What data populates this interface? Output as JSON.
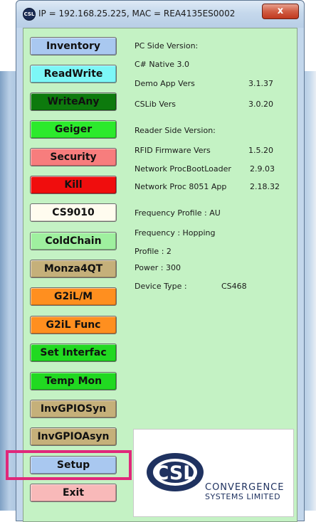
{
  "window": {
    "title": "IP = 192.168.25.225, MAC = REA4135ES0002",
    "close_label": "x",
    "app_icon_text": "CSL"
  },
  "buttons": [
    {
      "id": "inventory",
      "label": "Inventory",
      "bg": "#a9c8f0"
    },
    {
      "id": "readwrite",
      "label": "ReadWrite",
      "bg": "#7cf7f7"
    },
    {
      "id": "writeany",
      "label": "WriteAny",
      "bg": "#0d7a0d"
    },
    {
      "id": "geiger",
      "label": "Geiger",
      "bg": "#2cea2c"
    },
    {
      "id": "security",
      "label": "Security",
      "bg": "#f77d7d"
    },
    {
      "id": "kill",
      "label": "Kill",
      "bg": "#f00d0d"
    },
    {
      "id": "cs9010",
      "label": "CS9010",
      "bg": "#fffcef"
    },
    {
      "id": "coldchain",
      "label": "ColdChain",
      "bg": "#9ff09f"
    },
    {
      "id": "monza4qt",
      "label": "Monza4QT",
      "bg": "#c5b07a"
    },
    {
      "id": "g2ilm",
      "label": "G2iL/M",
      "bg": "#ff8f1f"
    },
    {
      "id": "g2ilfunc",
      "label": "G2iL Func",
      "bg": "#ff8f1f"
    },
    {
      "id": "setinterfac",
      "label": "Set Interfac",
      "bg": "#21d921"
    },
    {
      "id": "tempmon",
      "label": "Temp Mon",
      "bg": "#21d921"
    },
    {
      "id": "invgpiosyn",
      "label": "InvGPIOSyn",
      "bg": "#c5b07a"
    },
    {
      "id": "invgpioasyn",
      "label": "InvGPIOAsyn",
      "bg": "#c5b07a"
    },
    {
      "id": "setup",
      "label": "Setup",
      "bg": "#a9c8f0"
    },
    {
      "id": "exit",
      "label": "Exit",
      "bg": "#f8b9b9"
    }
  ],
  "info": {
    "pc_side_header": "PC Side Version:",
    "csharp_native": "C# Native 3.0",
    "demo_app_label": "Demo App Vers",
    "demo_app_value": "3.1.37",
    "cslib_label": "CSLib Vers",
    "cslib_value": "3.0.20",
    "reader_side_header": "Reader Side Version:",
    "rfid_fw_label": "RFID Firmware Vers",
    "rfid_fw_value": "1.5.20",
    "net_boot_label": "Network ProcBootLoader",
    "net_boot_value": "2.9.03",
    "net_proc_label": "Network Proc  8051 App",
    "net_proc_value": "2.18.32",
    "freq_profile": "Frequency Profile : AU",
    "frequency": "Frequency : Hopping",
    "profile": "Profile : 2",
    "power": "Power : 300",
    "device_type_label": "Device Type :",
    "device_type_value": "CS468"
  },
  "logo": {
    "mark": "CSL",
    "line1": "CONVERGENCE",
    "line2": "SYSTEMS LIMITED"
  },
  "colors": {
    "panel_bg": "#c4f2c4",
    "highlight": "#e0287a"
  }
}
